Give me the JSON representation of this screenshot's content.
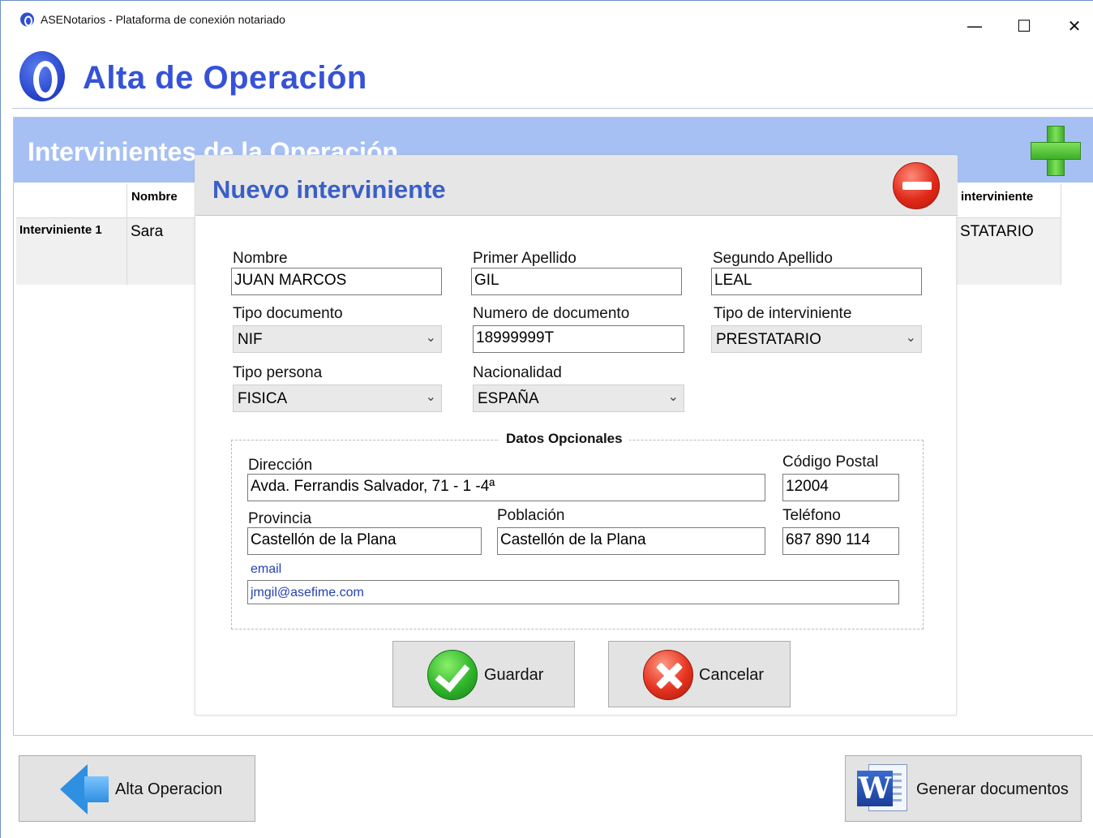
{
  "window": {
    "title": "ASENotarios - Plataforma de conexión notariado",
    "minimize": "—",
    "maximize": "☐",
    "close": "✕"
  },
  "header": {
    "title": "Alta de Operación"
  },
  "section": {
    "title": "Intervinientes de la Operación"
  },
  "grid": {
    "columns": [
      "Nombre",
      "interviniente"
    ],
    "rows": [
      {
        "header": "Interviniente 1",
        "nombre": "Sara",
        "tipo": "STATARIO"
      }
    ]
  },
  "dialog": {
    "title": "Nuevo interviniente",
    "fields": {
      "nombre": {
        "label": "Nombre",
        "value": "JUAN MARCOS"
      },
      "primer_apellido": {
        "label": "Primer Apellido",
        "value": "GIL"
      },
      "segundo_apellido": {
        "label": "Segundo Apellido",
        "value": "LEAL"
      },
      "tipo_documento": {
        "label": "Tipo documento",
        "value": "NIF"
      },
      "numero_documento": {
        "label": "Numero de documento",
        "value": "18999999T"
      },
      "tipo_interviniente": {
        "label": "Tipo de interviniente",
        "value": "PRESTATARIO"
      },
      "tipo_persona": {
        "label": "Tipo persona",
        "value": "FISICA"
      },
      "nacionalidad": {
        "label": "Nacionalidad",
        "value": "ESPAÑA"
      }
    },
    "optional": {
      "legend": "Datos Opcionales",
      "direccion": {
        "label": "Dirección",
        "value": "Avda. Ferrandis Salvador, 71 - 1 -4ª"
      },
      "codigo_postal": {
        "label": "Código Postal",
        "value": "12004"
      },
      "provincia": {
        "label": "Provincia",
        "value": "Castellón de la Plana"
      },
      "poblacion": {
        "label": "Población",
        "value": "Castellón de la Plana"
      },
      "telefono": {
        "label": "Teléfono",
        "value": "687 890 114"
      },
      "email": {
        "label": "email",
        "value": "jmgil@asefime.com"
      }
    },
    "buttons": {
      "guardar": "Guardar",
      "cancelar": "Cancelar"
    }
  },
  "footer": {
    "alta_operacion": "Alta Operacion",
    "generar_documentos": "Generar documentos"
  },
  "icons": {
    "app": "app-logo-icon",
    "add": "plus-icon",
    "remove": "minus-circle-icon",
    "save": "checkmark-icon",
    "cancel": "x-circle-icon",
    "back": "arrow-left-icon",
    "word": "word-document-icon"
  },
  "colors": {
    "accent": "#3552d8",
    "band": "#a7c0f4",
    "dialog_title": "#3a5fc8"
  }
}
